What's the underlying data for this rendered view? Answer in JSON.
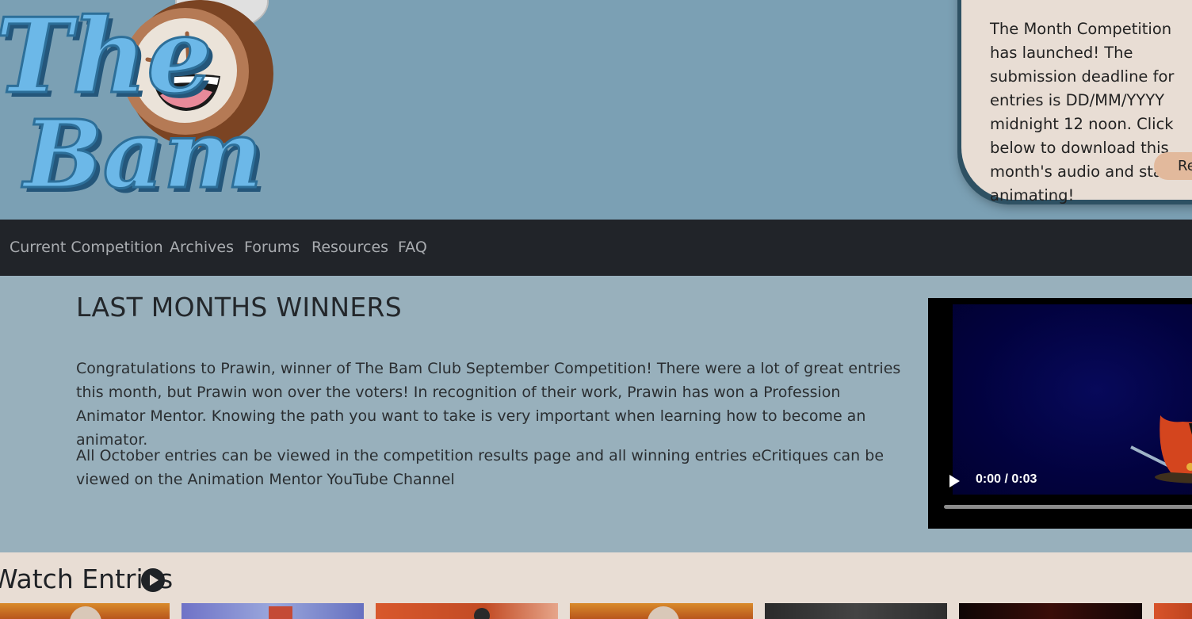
{
  "logo": {
    "line1": "The",
    "line2": "Bam",
    "mascot": "alarm-clock-face"
  },
  "announcement": {
    "text": "The Month Competition has launched! The submission deadline for entries is DD/MM/YYYY midnight 12 noon. Click below to download this month's audio and start animating!",
    "button_label": "Read More"
  },
  "nav": {
    "items": [
      "Current Competition",
      "Archives",
      "Forums",
      "Resources",
      "FAQ"
    ]
  },
  "winners": {
    "title": "LAST MONTHS WINNERS",
    "paragraph1": "Congratulations to Prawin, winner of The Bam Club September Competition! There were a lot of great entries this month, but Prawin won over the voters! In recognition of their work, Prawin has won a Profession Animator Mentor. Knowing the path you want to take is very important when learning how to become an animator.",
    "paragraph2": "All October entries can be viewed in the competition results page and all winning entries eCritiques can be viewed on the Animation Mentor YouTube Channel"
  },
  "video": {
    "time": "0:00 / 0:03",
    "progress": 0
  },
  "entries": {
    "title": "Watch Entries",
    "thumbnails": [
      "sunset-orange",
      "blue-purple",
      "orange-interior",
      "sunset-orange",
      "dark-grey",
      "dark-red",
      "orange-red"
    ]
  },
  "colors": {
    "header_bg": "#7ba0b4",
    "nav_bg": "#212429",
    "winners_bg": "#98b0bc",
    "page_bg": "#e8ddd4",
    "logo_blue": "#6cb8e8",
    "button_bg": "#e2b99c"
  }
}
